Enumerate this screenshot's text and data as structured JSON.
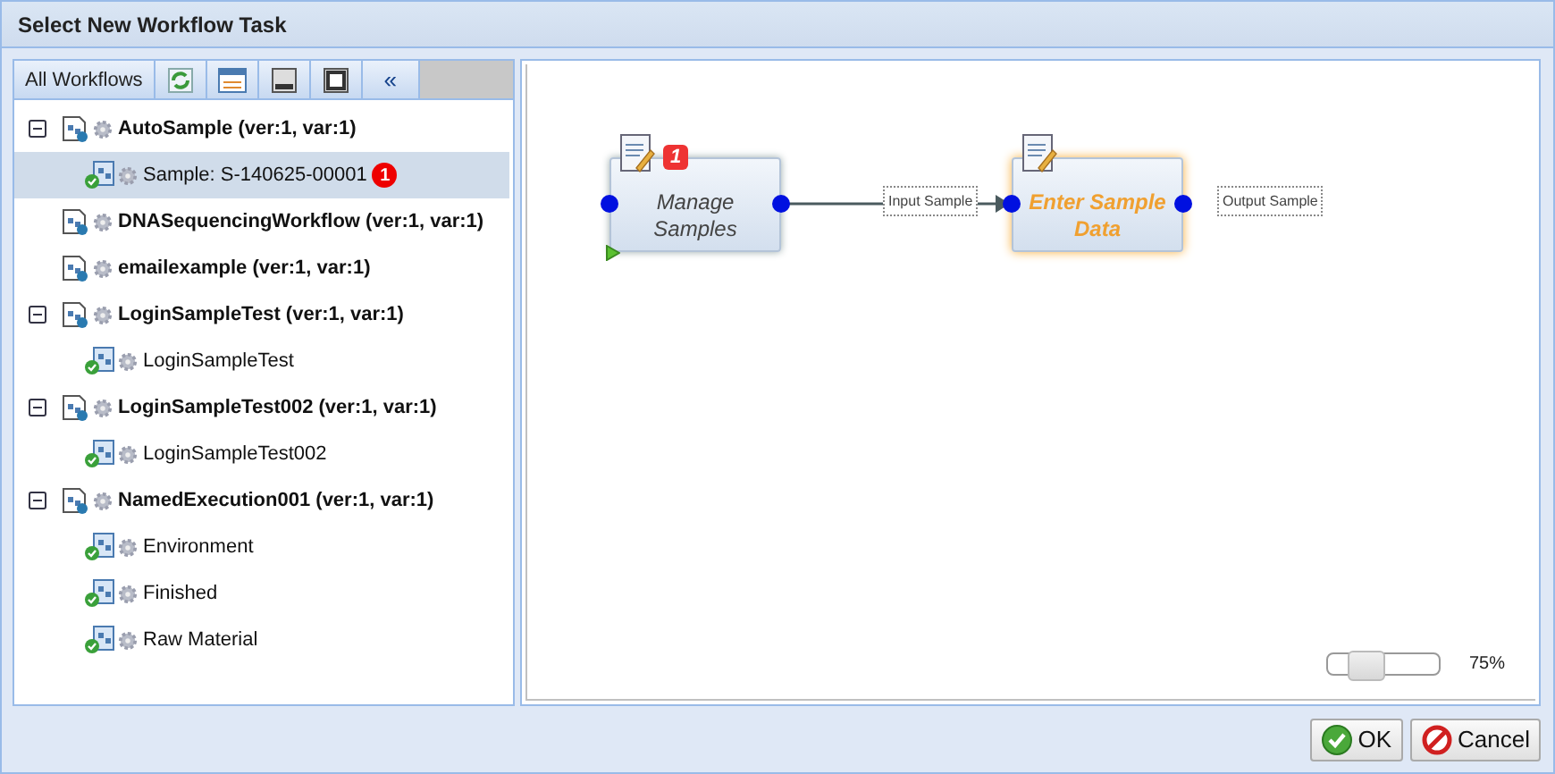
{
  "window": {
    "title": "Select New Workflow Task"
  },
  "sidebar": {
    "tab": "All Workflows",
    "collapse": "«",
    "tree": [
      {
        "label": "AutoSample (ver:1, var:1)",
        "kind": "workflow",
        "selected": false,
        "expanded": true,
        "children": [
          {
            "label": "Sample: S-140625-00001",
            "kind": "task",
            "selected": true,
            "badge": "1"
          }
        ]
      },
      {
        "label": "DNASequencingWorkflow (ver:1, var:1)",
        "kind": "workflow",
        "selected": false
      },
      {
        "label": "emailexample (ver:1, var:1)",
        "kind": "workflow",
        "selected": false
      },
      {
        "label": "LoginSampleTest (ver:1, var:1)",
        "kind": "workflow",
        "selected": false,
        "expanded": true,
        "children": [
          {
            "label": "LoginSampleTest",
            "kind": "task",
            "selected": false
          }
        ]
      },
      {
        "label": "LoginSampleTest002 (ver:1, var:1)",
        "kind": "workflow",
        "selected": false,
        "expanded": true,
        "children": [
          {
            "label": "LoginSampleTest002",
            "kind": "task",
            "selected": false
          }
        ]
      },
      {
        "label": "NamedExecution001 (ver:1, var:1)",
        "kind": "workflow",
        "selected": false,
        "expanded": true,
        "children": [
          {
            "label": "Environment",
            "kind": "task",
            "selected": false
          },
          {
            "label": "Finished",
            "kind": "task",
            "selected": false
          },
          {
            "label": "Raw Material",
            "kind": "task",
            "selected": false
          }
        ]
      }
    ]
  },
  "diagram": {
    "nodes": [
      {
        "title": "Manage Samples",
        "badge": "1",
        "active": false,
        "start": true
      },
      {
        "title": "Enter Sample Data",
        "active": true,
        "start": false
      }
    ],
    "port_labels": [
      "Input Sample",
      "Output Sample"
    ],
    "zoom": {
      "level": 0.25,
      "reading": "75%"
    }
  },
  "buttons": [
    {
      "label": "OK",
      "kind": "ok"
    },
    {
      "label": "Cancel",
      "kind": "cancel"
    }
  ]
}
